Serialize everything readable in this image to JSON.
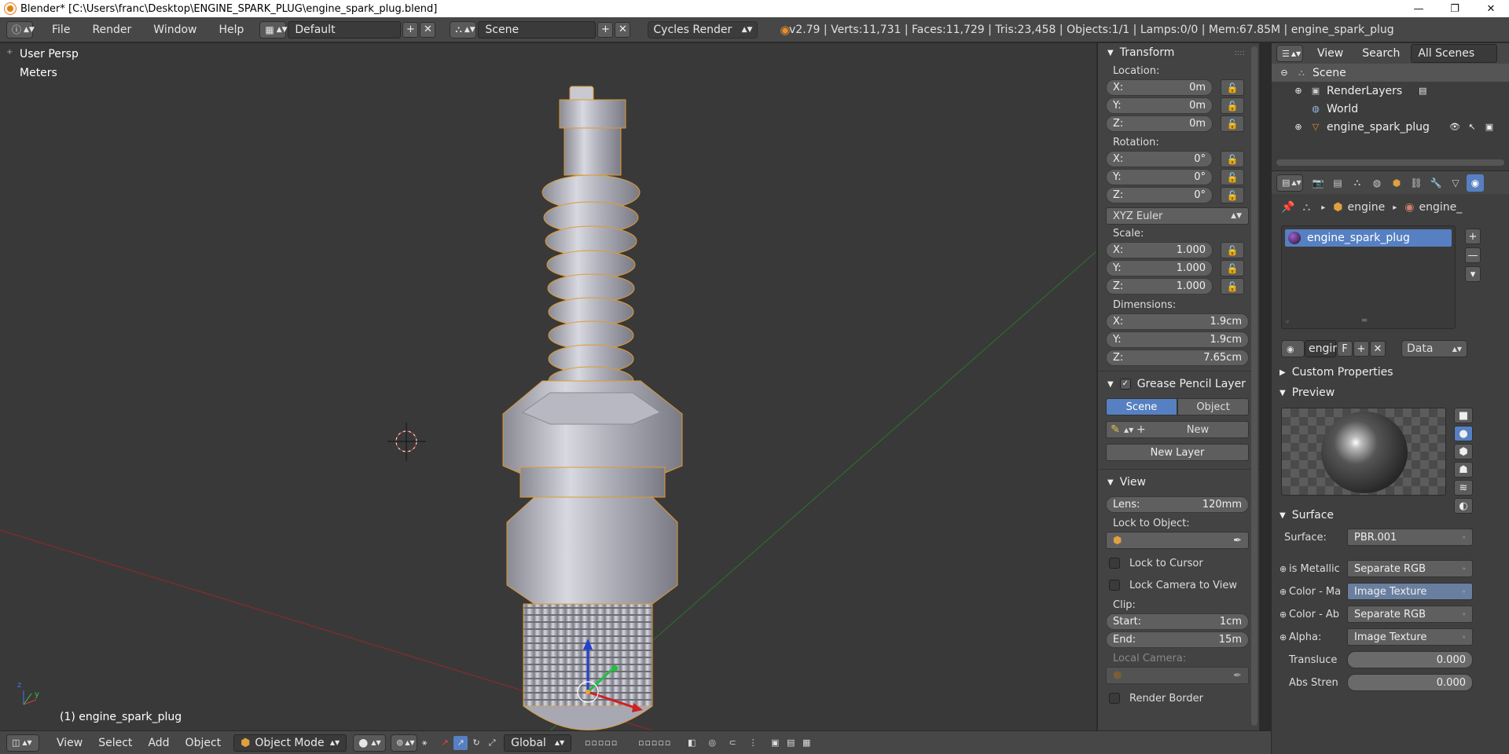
{
  "window": {
    "title": "Blender* [C:\\Users\\franc\\Desktop\\ENGINE_SPARK_PLUG\\engine_spark_plug.blend]",
    "minimize": "—",
    "maximize": "❐",
    "close": "✕"
  },
  "menu": {
    "file": "File",
    "render": "Render",
    "window": "Window",
    "help": "Help"
  },
  "screen_layout": "Default",
  "scene_name": "Scene",
  "render_engine": "Cycles Render",
  "stats": "v2.79 | Verts:11,731 | Faces:11,729 | Tris:23,458 | Objects:1/1 | Lamps:0/0 | Mem:67.85M | engine_spark_plug",
  "viewport": {
    "view_name": "User Persp",
    "units": "Meters",
    "object_label": "(1) engine_spark_plug"
  },
  "transform": {
    "title": "Transform",
    "location_label": "Location:",
    "location": {
      "x": "0m",
      "y": "0m",
      "z": "0m"
    },
    "rotation_label": "Rotation:",
    "rotation": {
      "x": "0°",
      "y": "0°",
      "z": "0°"
    },
    "rotation_mode": "XYZ Euler",
    "scale_label": "Scale:",
    "scale": {
      "x": "1.000",
      "y": "1.000",
      "z": "1.000"
    },
    "dimensions_label": "Dimensions:",
    "dimensions": {
      "x": "1.9cm",
      "y": "1.9cm",
      "z": "7.65cm"
    },
    "axis_x": "X:",
    "axis_y": "Y:",
    "axis_z": "Z:"
  },
  "grease_pencil": {
    "title": "Grease Pencil Layer",
    "tab_scene": "Scene",
    "tab_object": "Object",
    "new": "New",
    "new_layer": "New Layer"
  },
  "view_panel": {
    "title": "View",
    "lens_label": "Lens:",
    "lens_value": "120mm",
    "lock_to_object": "Lock to Object:",
    "lock_to_cursor": "Lock to Cursor",
    "lock_camera": "Lock Camera to View",
    "clip_label": "Clip:",
    "clip_start_label": "Start:",
    "clip_start": "1cm",
    "clip_end_label": "End:",
    "clip_end": "15m",
    "local_camera": "Local Camera:",
    "render_border": "Render Border"
  },
  "outliner": {
    "view": "View",
    "search": "Search",
    "all_scenes": "All Scenes",
    "items": [
      "Scene",
      "RenderLayers",
      "World",
      "engine_spark_plug"
    ]
  },
  "properties": {
    "breadcrumb_object": "engine",
    "breadcrumb_material": "engine_",
    "material_slot": "engine_spark_plug",
    "material_field": "engin",
    "fake_user": "F",
    "link": "Data",
    "custom_properties": "Custom Properties",
    "preview": "Preview",
    "surface_title": "Surface",
    "surface_rows": [
      {
        "label": "Surface:",
        "value": "PBR.001"
      },
      {
        "label": "is Metallic",
        "value": "Separate RGB"
      },
      {
        "label": "Color - Ma",
        "value": "Image Texture"
      },
      {
        "label": "Color - Ab",
        "value": "Separate RGB"
      },
      {
        "label": "Alpha:",
        "value": "Image Texture"
      },
      {
        "label": "Transluce",
        "value": "0.000"
      },
      {
        "label": "Abs Stren",
        "value": "0.000"
      }
    ]
  },
  "bottom": {
    "view": "View",
    "select": "Select",
    "add": "Add",
    "object": "Object",
    "mode": "Object Mode",
    "orientation": "Global"
  }
}
